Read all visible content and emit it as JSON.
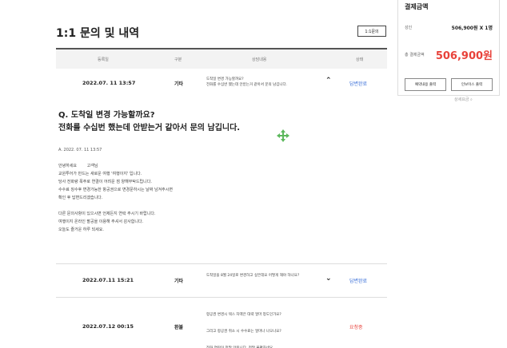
{
  "summary": {
    "title": "결제금액",
    "detail_label": "상세요금",
    "price_label": "성인",
    "price_value": "506,900원 X 1명",
    "total_label": "총 결제금액",
    "total_value": "506,900원",
    "btn_reservation": "예약내용 출력",
    "btn_invoice": "인보이스 출력"
  },
  "page": {
    "title": "1:1 문의 및 내역",
    "inquiry_button": "1:1문의"
  },
  "table": {
    "headers": [
      "등록일",
      "구분",
      "상담내용",
      "상태"
    ]
  },
  "rows": [
    {
      "date": "2022.07. 11 13:57",
      "category": "기타",
      "content": "도착일 변경 가능할까요?\n전화를 수십번 했는데 안받는거 같아서 문의 남깁니다.",
      "status": "답변완료"
    },
    {
      "date": "2022.07.11 15:21",
      "category": "기타",
      "content": "도착일을 8월 24일로 변경하고 싶은데요 어떻게 해야 하나요?",
      "status": "답변완료"
    },
    {
      "date": "2022.07.12 00:15",
      "category": "환불",
      "content": "항공권 변경시 텍스 차액은 대략 얼마 정도인가요?\n그리고 항공권 취소 시 수수료는 얼마나 나오나요?\n전화 연락이 정말 안됩니다. 정말 불편하네요.",
      "status": "요청중"
    }
  ],
  "detail": {
    "question": "Q. 도착일 변경 가능할까요?\n전화를 수십번 했는데 안받는거 같아서 문의 남깁니다.",
    "answer_date": "A. 2022. 07. 11 13:57",
    "answer_lines": [
      "안녕하세요        고객님",
      "교원투어가 만드는 새로운 여행 '여행이지' 입니다.",
      "당사 전화량 폭주로 연결이 어려운 점 양해부탁드립니다.",
      "수수료 징수후 변경가능한 항공권으로 변경문하시는 날짜 남겨주시면",
      "확인 후 답변드리겠습니다.",
      "",
      "다른 문의사항이 있으시면 언제든지 연락 주시기 바랍니다.",
      "여행이지 온라인 팔공을 이용해 주셔서 감사합니다.",
      "오늘도 즐거운 하루 되세요."
    ]
  },
  "icons": {
    "move": "move-cross-icon",
    "accent_green": "#5cb85c"
  }
}
